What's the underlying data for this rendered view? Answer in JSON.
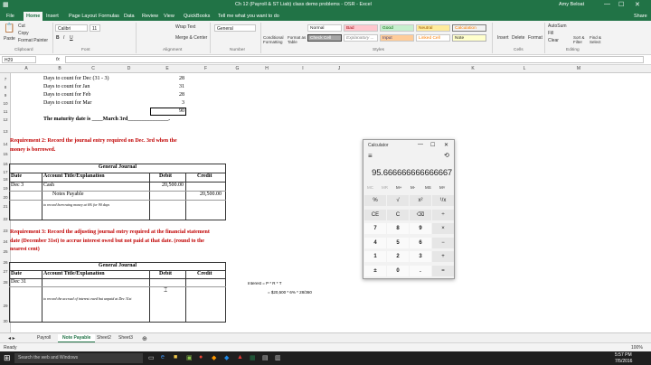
{
  "window": {
    "title": "Ch 12 (Payroll & ST Liab) class demo problems - OSR - Excel",
    "user": "Amy Beloat",
    "min": "—",
    "max": "☐",
    "close": "✕"
  },
  "tabs": [
    "File",
    "Home",
    "Insert",
    "Page Layout",
    "Formulas",
    "Data",
    "Review",
    "View",
    "QuickBooks",
    "Tell me what you want to do"
  ],
  "tabs_right": [
    "Share"
  ],
  "ribbon": {
    "paste": "Paste",
    "cut": "Cut",
    "copy": "Copy",
    "format_painter": "Format Painter",
    "font": "Calibri",
    "font_size": "11",
    "bold": "B",
    "italic": "I",
    "underline": "U",
    "wrap": "Wrap Text",
    "merge": "Merge & Center",
    "number_format": "General",
    "cond": "Conditional Formatting",
    "fmt_table": "Format as Table",
    "styles": [
      "Normal",
      "Bad",
      "Good",
      "Neutral",
      "Calculation",
      "Check Cell",
      "Explanatory ...",
      "Input",
      "Linked Cell",
      "Note"
    ],
    "insert": "Insert",
    "delete": "Delete",
    "format": "Format",
    "autosum": "AutoSum",
    "fill": "Fill",
    "clear": "Clear",
    "sort": "Sort & Filter",
    "find": "Find & Select",
    "groups": [
      "Clipboard",
      "Font",
      "Alignment",
      "Number",
      "Styles",
      "Cells",
      "Editing"
    ]
  },
  "namebox": "H29",
  "fx": "fx",
  "columns": [
    "A",
    "B",
    "C",
    "D",
    "E",
    "F",
    "G",
    "H",
    "I",
    "J",
    "K",
    "L",
    "M"
  ],
  "rows": [
    "7",
    "8",
    "9",
    "10",
    "11",
    "12",
    "13",
    "14",
    "15",
    "16",
    "17",
    "18",
    "19",
    "20",
    "21",
    "22",
    "23",
    "24",
    "25",
    "26",
    "27",
    "28",
    "29",
    "30"
  ],
  "sheet": {
    "r7": {
      "label": "Days to count for Dec (31 - 3)",
      "val": "28"
    },
    "r8": {
      "label": "Days to count for Jan",
      "val": "31"
    },
    "r9": {
      "label": "Days to count for Feb",
      "val": "28"
    },
    "r10": {
      "label": "Days to count for Mar",
      "val": "3"
    },
    "r11": {
      "val": "90"
    },
    "r12": {
      "label": "The maturity date is ____March 3rd_______________."
    },
    "req2_a": "Requirement 2: Record the journal entry required on Dec. 3rd when the",
    "req2_b": "money is borrowed.",
    "gj1_title": "General Journal",
    "hdr": {
      "date": "Date",
      "acct": "Account Title/Explanation",
      "debit": "Debit",
      "credit": "Credit"
    },
    "gj1_rows": [
      {
        "date": "Dec 3",
        "acct": "Cash",
        "debit": "20,500.00",
        "credit": ""
      },
      {
        "date": "",
        "acct": "Notes Payable",
        "debit": "",
        "credit": "20,500.00"
      },
      {
        "date": "",
        "acct": "to record borrowing money at 6% for 90 days",
        "debit": "",
        "credit": ""
      }
    ],
    "req3_a": "Requirement 3: Record the adjusting journal entry required at the financial statement",
    "req3_b": "date (December 31st) to accrue interest owed but not paid at that date. (round to the",
    "req3_c": "nearest cent)",
    "gj2_title": "General Journal",
    "gj2_rows": [
      {
        "date": "Dec 31",
        "acct": ""
      },
      {
        "date": "",
        "acct": "to record the accrual of interest owed but unpaid at Dec 31st"
      }
    ],
    "interest_label": "Interest = P * R * T",
    "interest_formula": "= $20,500 * 6% * 28/360"
  },
  "sheet_tabs": [
    "Payroll",
    "Note Payable",
    "Sheet2",
    "Sheet3"
  ],
  "active_sheet": "Note Payable",
  "status": {
    "left": "Ready",
    "zoom": "100%"
  },
  "taskbar": {
    "search": "Search the web and Windows",
    "time": "5:57 PM",
    "date": "7/5/2016"
  },
  "calculator": {
    "title": "Calculator",
    "display": "95.666666666666667",
    "memory": [
      "MC",
      "MR",
      "M+",
      "M-",
      "MS",
      "M˅"
    ],
    "keys": [
      [
        "%",
        "√",
        "x²",
        "¹/x"
      ],
      [
        "CE",
        "C",
        "⌫",
        "÷"
      ],
      [
        "7",
        "8",
        "9",
        "×"
      ],
      [
        "4",
        "5",
        "6",
        "−"
      ],
      [
        "1",
        "2",
        "3",
        "+"
      ],
      [
        "±",
        "0",
        ".",
        "="
      ]
    ]
  },
  "colors": {
    "excel_green": "#217346",
    "req_red": "#c00000"
  }
}
